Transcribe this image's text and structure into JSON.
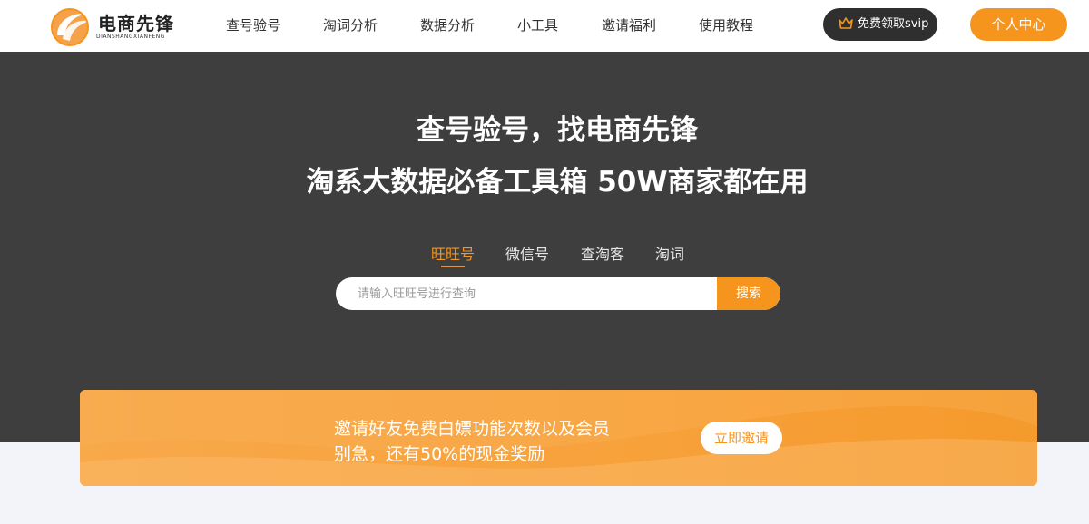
{
  "brand": {
    "name": "电商先锋",
    "subtitle": "DIANSHANGXIANFENG",
    "logo_icon": "swirl-logo-icon",
    "accent_color": "#f5951e"
  },
  "nav": {
    "items": [
      {
        "label": "查号验号"
      },
      {
        "label": "淘词分析"
      },
      {
        "label": "数据分析"
      },
      {
        "label": "小工具"
      },
      {
        "label": "邀请福利"
      },
      {
        "label": "使用教程"
      }
    ],
    "svip_label": "免费领取svip",
    "svip_icon": "crown-icon",
    "personal_label": "个人中心"
  },
  "hero": {
    "headline_1": "查号验号，找电商先锋",
    "headline_2": "淘系大数据必备工具箱 50W商家都在用",
    "tabs": [
      {
        "label": "旺旺号",
        "active": true
      },
      {
        "label": "微信号",
        "active": false
      },
      {
        "label": "查淘客",
        "active": false
      },
      {
        "label": "淘词",
        "active": false
      }
    ],
    "search": {
      "placeholder": "请输入旺旺号进行查询",
      "value": "",
      "button_label": "搜索"
    }
  },
  "banner": {
    "line_1": "邀请好友免费白嫖功能次数以及会员",
    "line_2": "别急，还有50%的现金奖励",
    "button_label": "立即邀请"
  }
}
